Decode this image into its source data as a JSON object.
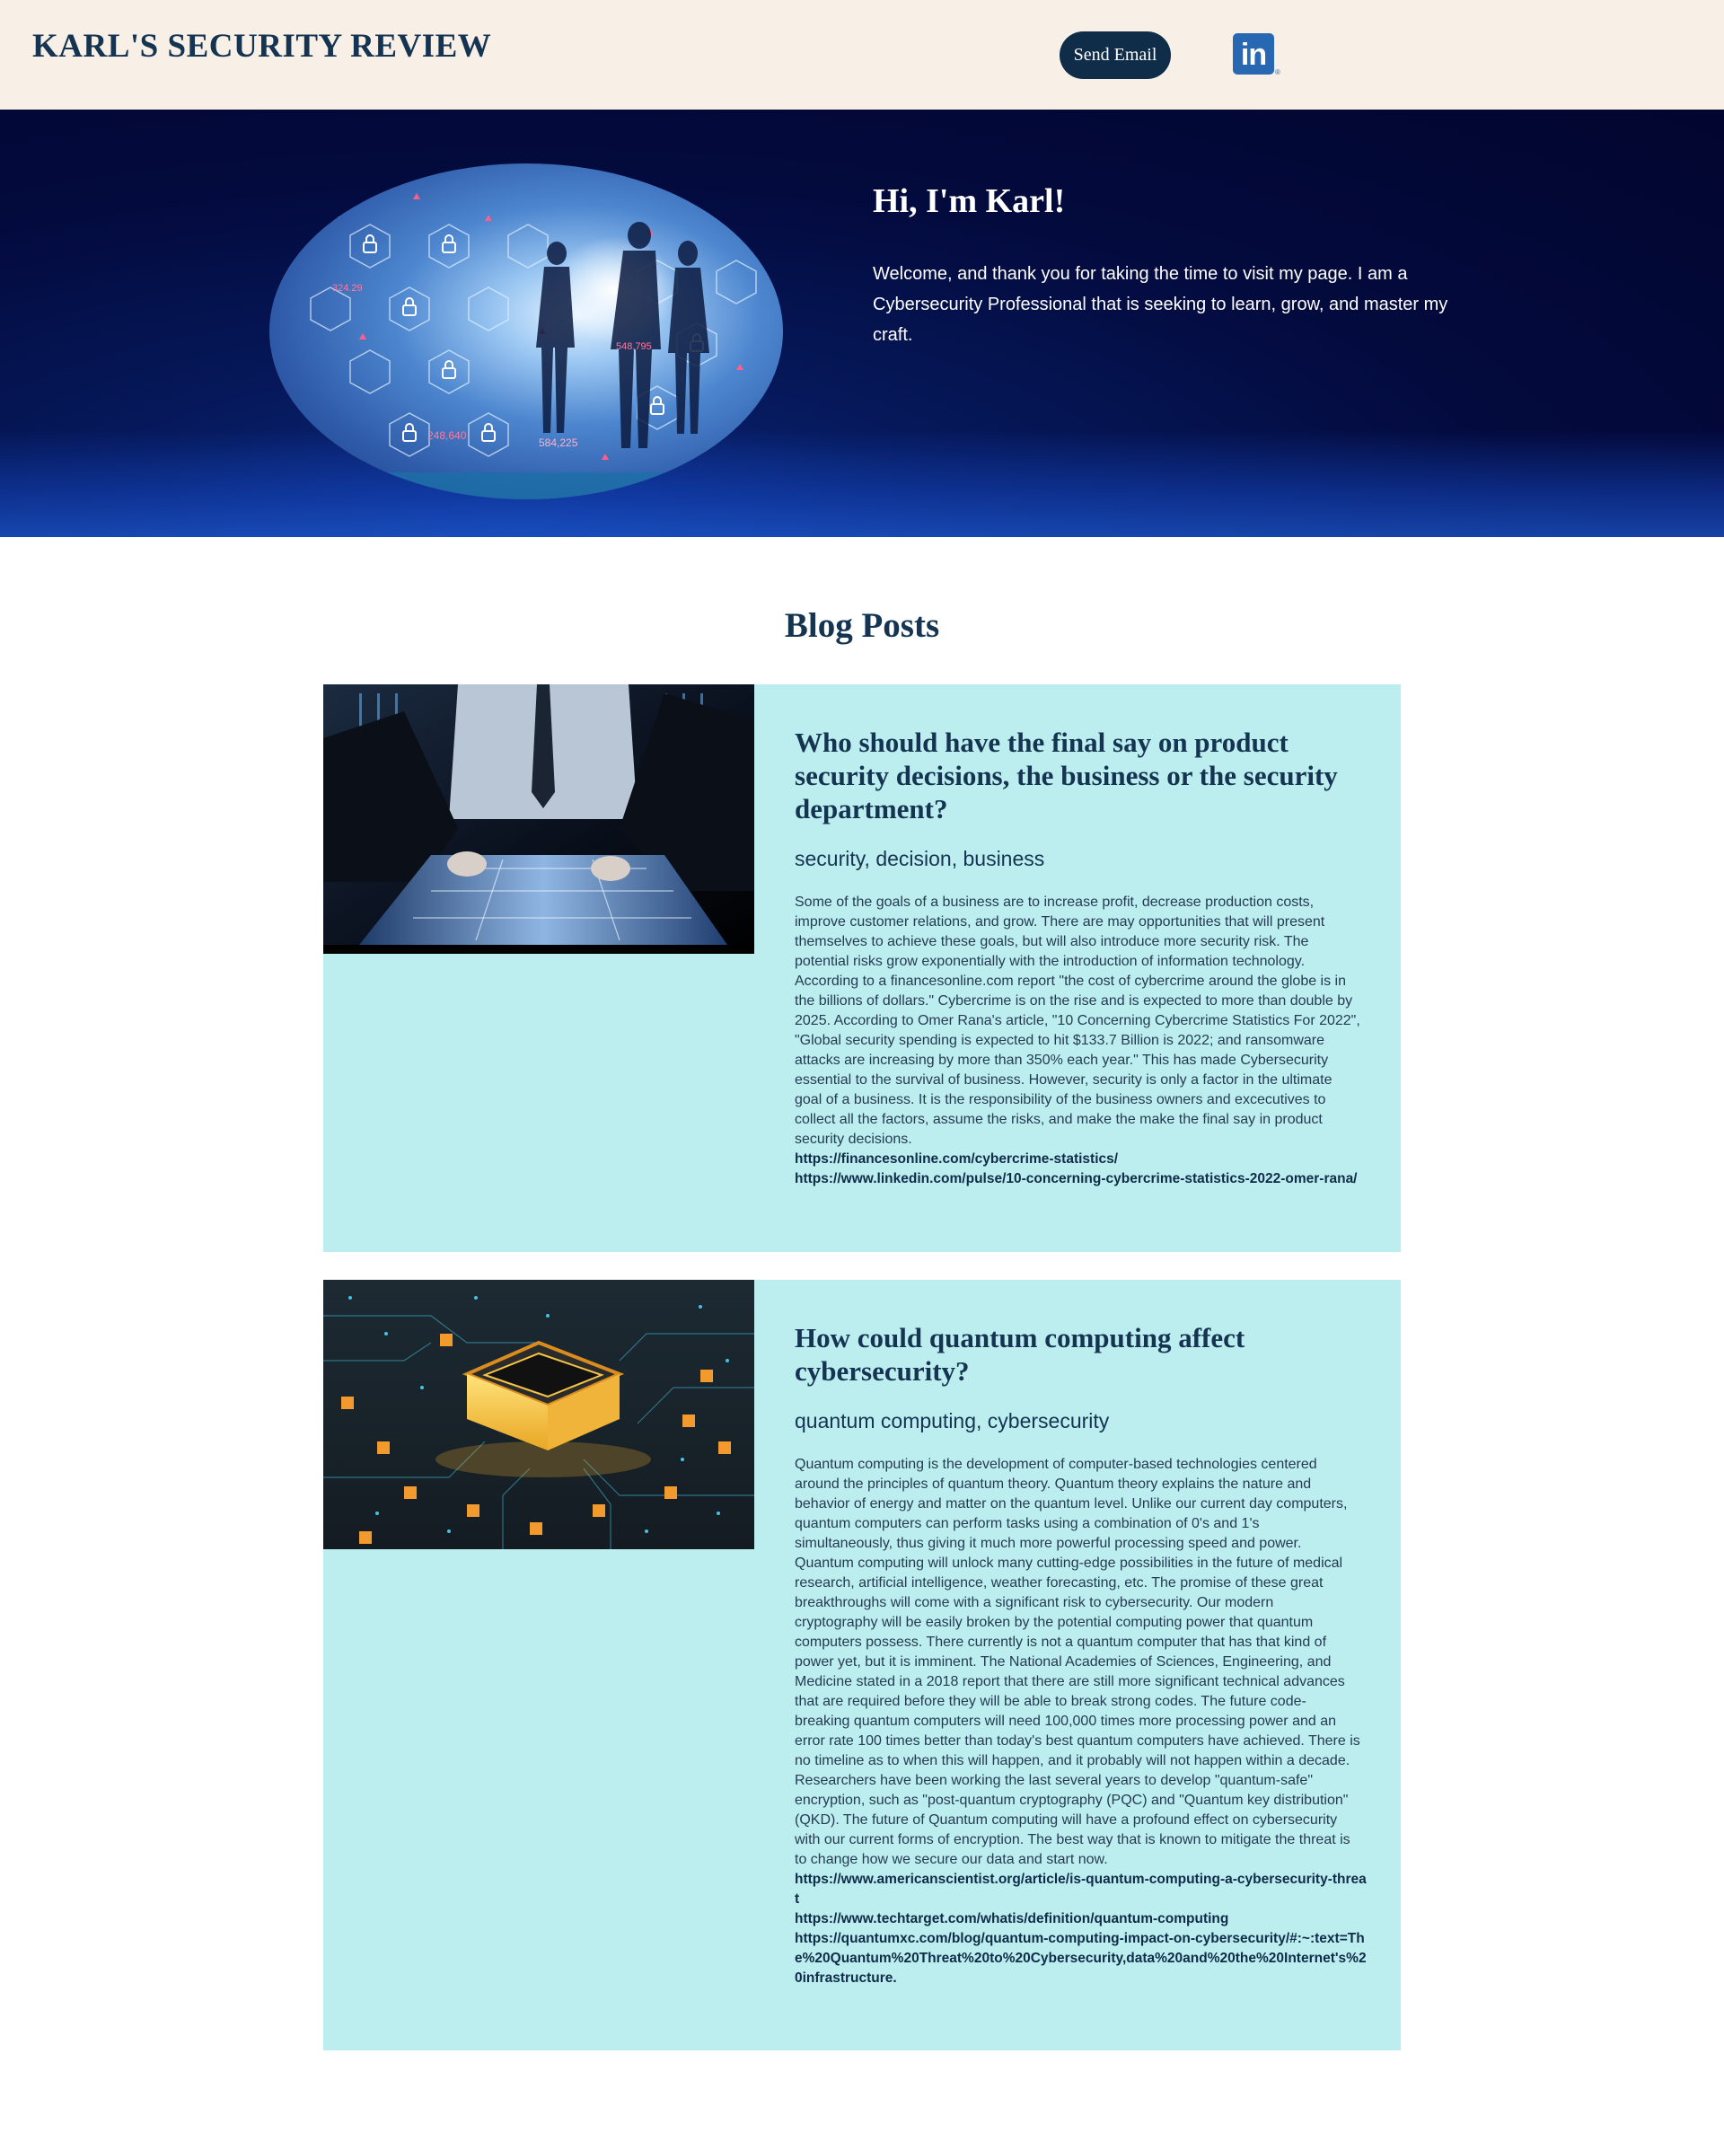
{
  "header": {
    "brand": "KARL'S SECURITY REVIEW",
    "send_email_label": "Send Email",
    "linkedin_glyph": "in",
    "linkedin_reg": "®"
  },
  "hero": {
    "title": "Hi, I'm Karl!",
    "text": "Welcome, and thank you for taking the time to visit my page. I am a Cybersecurity Professional that is seeking to learn, grow, and master my craft.",
    "overlay_numbers": [
      "324.29",
      "248,640",
      "584,225",
      "548,795"
    ]
  },
  "blog": {
    "heading": "Blog Posts",
    "posts": [
      {
        "title": "Who should have the final say on product security decisions, the business or the security department?",
        "tags": "security, decision, business",
        "body": "Some of the goals of a business are to increase profit, decrease production costs, improve customer relations, and grow. There are may opportunities that will present themselves to achieve these goals, but will also introduce more security risk. The potential risks grow exponentially with the introduction of information technology. According to a financesonline.com report \"the cost of cybercrime around the globe is in the billions of dollars.\" Cybercrime is on the rise and is expected to more than double by 2025. According to Omer Rana's article, \"10 Concerning Cybercrime Statistics For 2022\", \"Global security spending is expected to hit $133.7 Billion is 2022; and ransomware attacks are increasing by more than 350% each year.\" This has made Cybersecurity essential to the survival of business. However, security is only a factor in the ultimate goal of a business. It is the responsibility of the business owners and excecutives to collect all the factors, assume the risks, and make the make the final say in product security decisions.",
        "links": [
          "https://financesonline.com/cybercrime-statistics/",
          "https://www.linkedin.com/pulse/10-concerning-cybercrime-statistics-2022-omer-rana/"
        ]
      },
      {
        "title": "How could quantum computing affect cybersecurity?",
        "tags": "quantum computing, cybersecurity",
        "body": "Quantum computing is the development of computer-based technologies centered around the principles of quantum theory. Quantum theory explains the nature and behavior of energy and matter on the quantum level. Unlike our current day computers, quantum computers can perform tasks using a combination of 0's and 1's simultaneously, thus giving it much more powerful processing speed and power. Quantum computing will unlock many cutting-edge possibilities in the future of medical research, artificial intelligence, weather forecasting, etc. The promise of these great breakthroughs will come with a significant risk to cybersecurity. Our modern cryptography will be easily broken by the potential computing power that quantum computers possess. There currently is not a quantum computer that has that kind of power yet, but it is imminent. The National Academies of Sciences, Engineering, and Medicine stated in a 2018 report that there are still more significant technical advances that are required before they will be able to break strong codes. The future code-breaking quantum computers will need 100,000 times more processing power and an error rate 100 times better than today's best quantum computers have achieved. There is no timeline as to when this will happen, and it probably will not happen within a decade. Researchers have been working the last several years to develop \"quantum-safe\" encryption, such as \"post-quantum cryptography (PQC) and \"Quantum key distribution\" (QKD). The future of Quantum computing will have a profound effect on cybersecurity with our current forms of encryption. The best way that is known to mitigate the threat is to change how we secure our data and start now.",
        "links": [
          "https://www.americanscientist.org/article/is-quantum-computing-a-cybersecurity-threat",
          "https://www.techtarget.com/whatis/definition/quantum-computing",
          "https://quantumxc.com/blog/quantum-computing-impact-on-cybersecurity/#:~:text=The%20Quantum%20Threat%20to%20Cybersecurity,data%20and%20the%20Internet's%20infrastructure."
        ]
      }
    ]
  },
  "icons": {
    "linkedin": "linkedin-icon",
    "hero_image": "cyber-network-image",
    "post_1_image": "touchscreen-table-image",
    "post_2_image": "quantum-chip-image"
  },
  "colors": {
    "header_bg": "#f8efe6",
    "brand_navy": "#143452",
    "post_bg": "#bdeeef",
    "hero_bg": "#02052e",
    "linkedin_blue": "#2867b2"
  }
}
